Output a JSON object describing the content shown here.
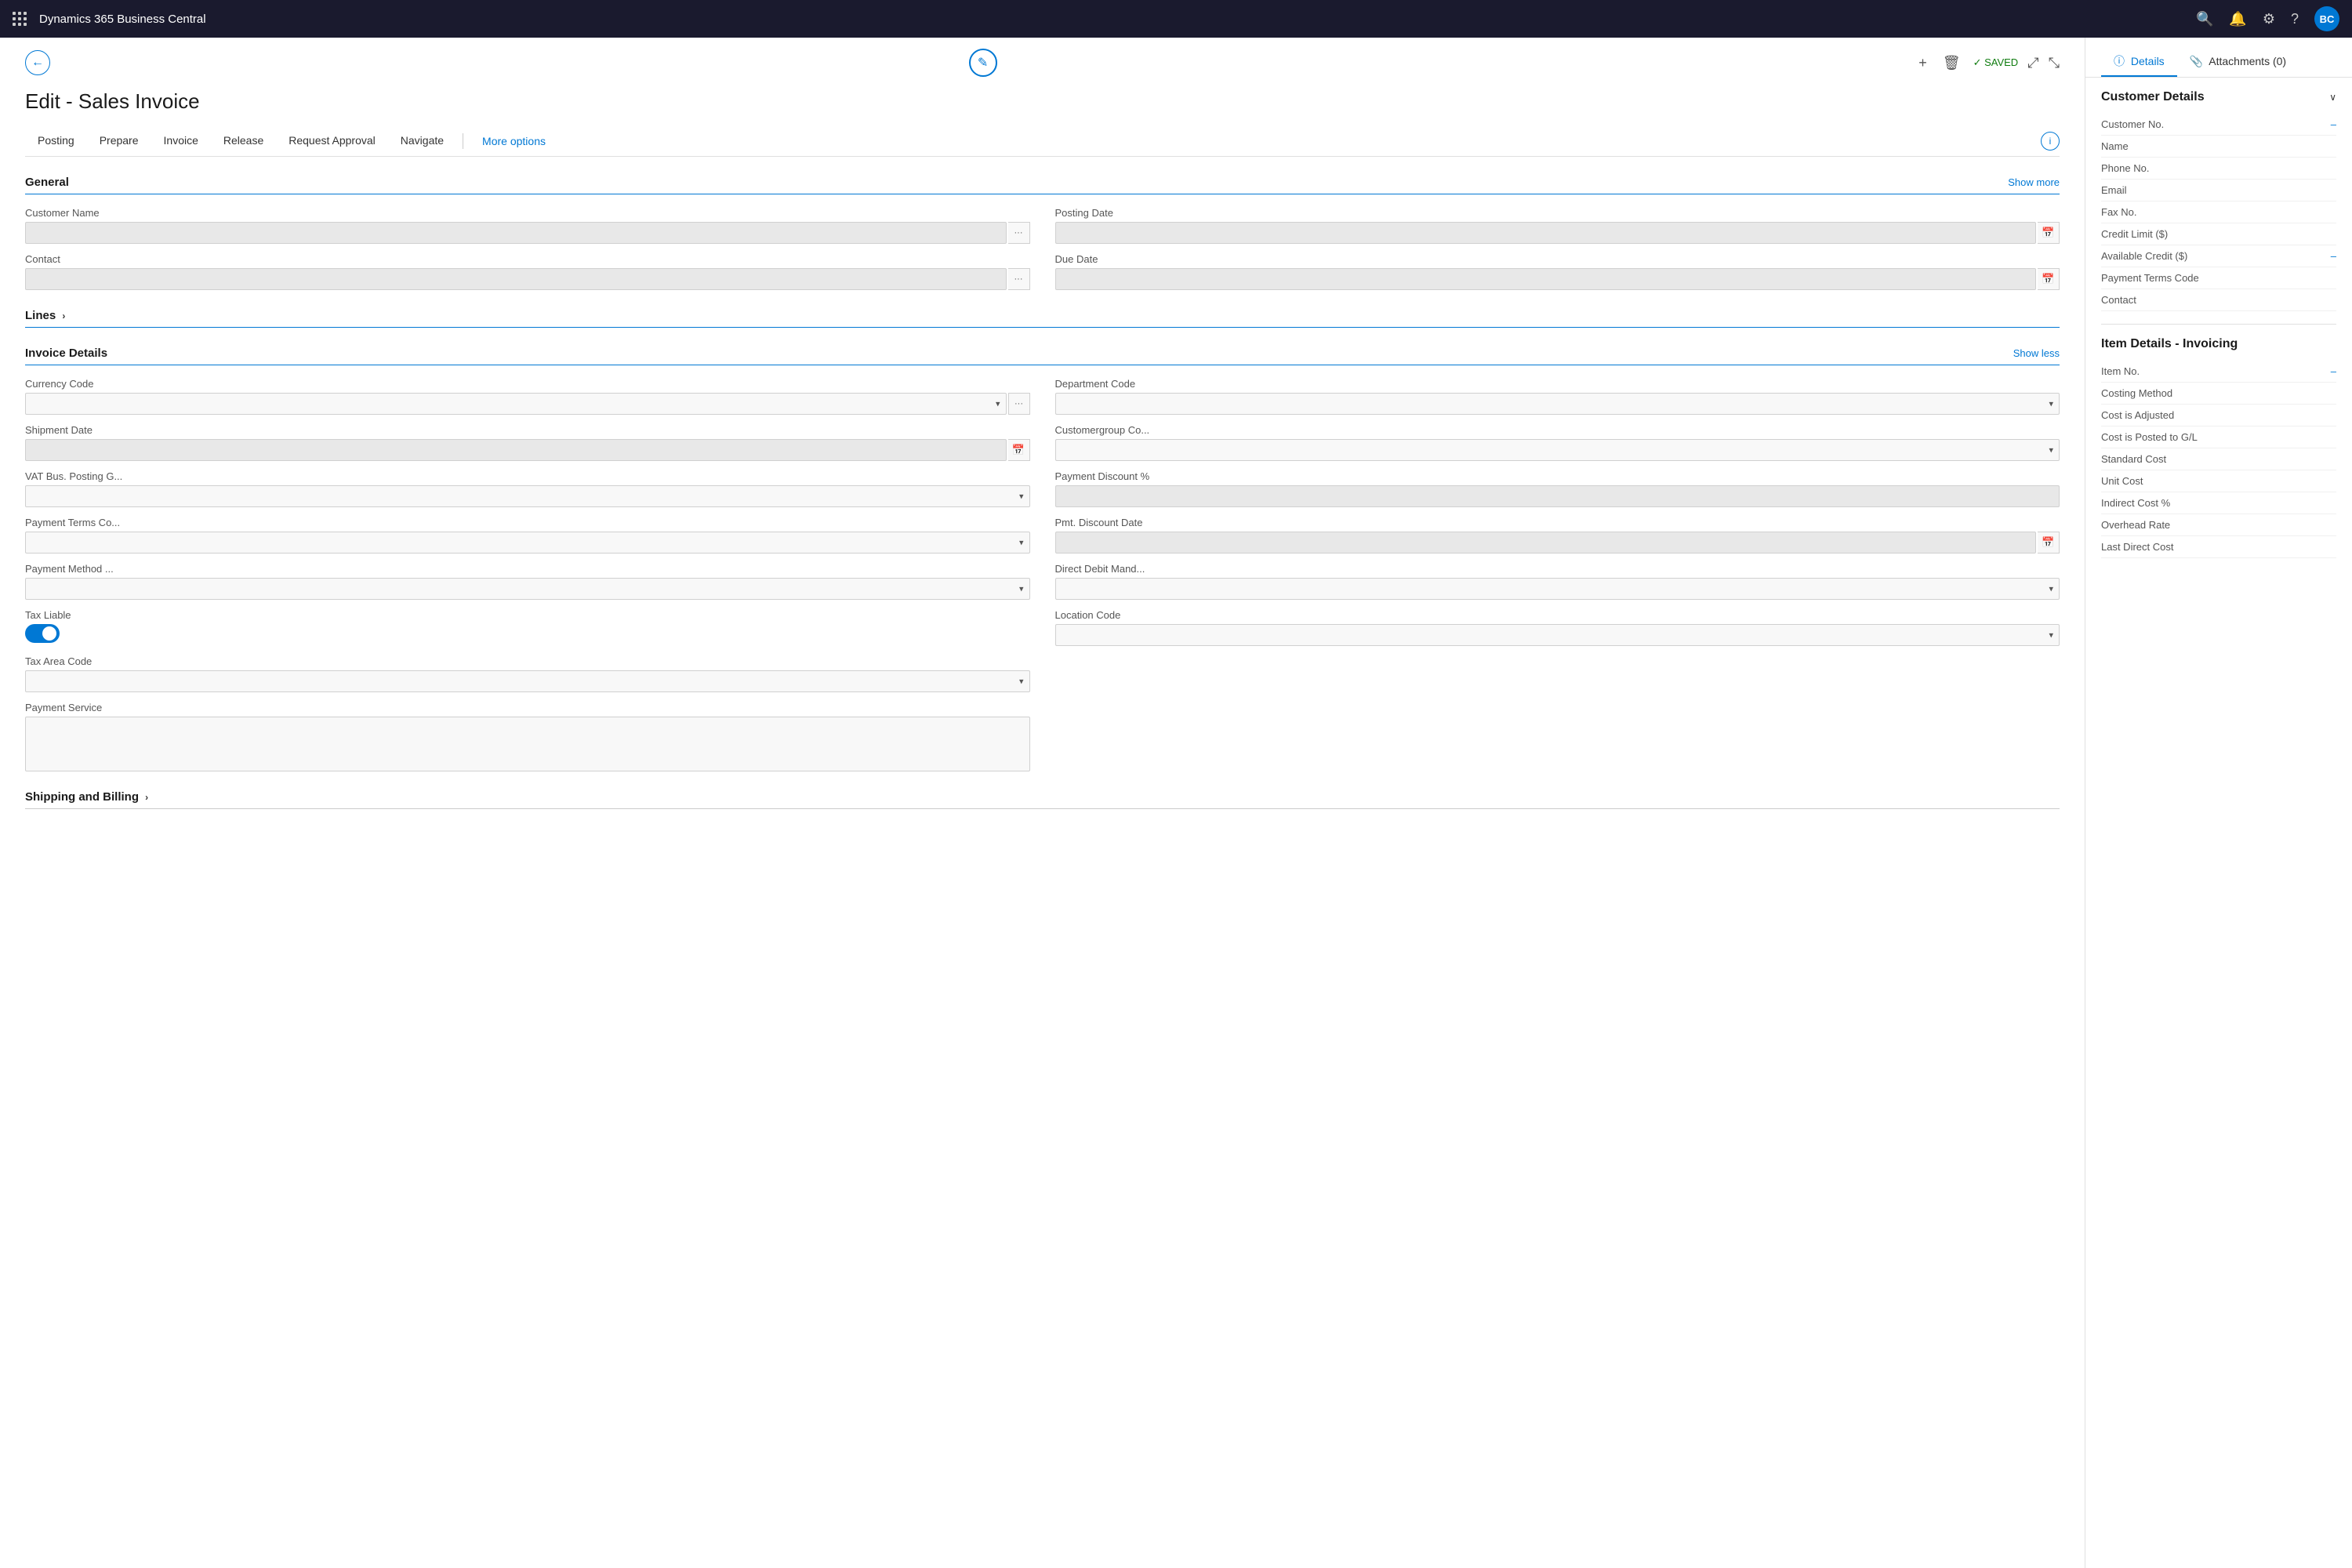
{
  "app": {
    "name": "Dynamics 365 Business Central",
    "user_initials": "BC"
  },
  "toolbar": {
    "back_label": "←",
    "edit_icon": "✎",
    "add_icon": "+",
    "delete_icon": "🗑",
    "saved_label": "✓ SAVED",
    "expand_icon": "⤢",
    "collapse_icon": "⤡"
  },
  "page": {
    "title": "Edit - Sales Invoice"
  },
  "nav": {
    "tabs": [
      {
        "label": "Posting",
        "active": false
      },
      {
        "label": "Prepare",
        "active": false
      },
      {
        "label": "Invoice",
        "active": false
      },
      {
        "label": "Release",
        "active": false
      },
      {
        "label": "Request Approval",
        "active": false
      },
      {
        "label": "Navigate",
        "active": false
      }
    ],
    "more_options": "More options"
  },
  "general": {
    "title": "General",
    "show_more": "Show more",
    "fields": [
      {
        "label": "Customer Name",
        "type": "input_with_btn",
        "value": "",
        "placeholder": ""
      },
      {
        "label": "Posting Date",
        "type": "date",
        "value": "",
        "placeholder": ""
      },
      {
        "label": "Contact",
        "type": "input_with_btn",
        "value": "",
        "placeholder": ""
      },
      {
        "label": "Due Date",
        "type": "date",
        "value": "",
        "placeholder": ""
      }
    ]
  },
  "lines": {
    "title": "Lines"
  },
  "invoice_details": {
    "title": "Invoice Details",
    "show_less": "Show less",
    "fields_left": [
      {
        "label": "Currency Code",
        "type": "select_with_btn",
        "value": ""
      },
      {
        "label": "Shipment Date",
        "type": "date",
        "value": ""
      },
      {
        "label": "VAT Bus. Posting G...",
        "type": "select",
        "value": ""
      },
      {
        "label": "Payment Terms Co...",
        "type": "select",
        "value": ""
      },
      {
        "label": "Payment Method ...",
        "type": "select",
        "value": ""
      },
      {
        "label": "Tax Liable",
        "type": "toggle",
        "value": true
      },
      {
        "label": "Tax Area Code",
        "type": "select",
        "value": ""
      },
      {
        "label": "Payment Service",
        "type": "textarea",
        "value": ""
      }
    ],
    "fields_right": [
      {
        "label": "Department Code",
        "type": "select",
        "value": ""
      },
      {
        "label": "Customergroup Co...",
        "type": "select",
        "value": ""
      },
      {
        "label": "Payment Discount %",
        "type": "input",
        "value": ""
      },
      {
        "label": "Pmt. Discount Date",
        "type": "date",
        "value": ""
      },
      {
        "label": "Direct Debit Mand...",
        "type": "select",
        "value": ""
      },
      {
        "label": "Location Code",
        "type": "select",
        "value": ""
      }
    ]
  },
  "shipping": {
    "title": "Shipping and Billing"
  },
  "right_panel": {
    "tabs": [
      {
        "label": "Details",
        "icon": "ⓘ",
        "active": true
      },
      {
        "label": "Attachments (0)",
        "icon": "📎",
        "active": false
      }
    ],
    "customer_details": {
      "title": "Customer Details",
      "fields": [
        {
          "label": "Customer No.",
          "value": "–"
        },
        {
          "label": "Name",
          "value": ""
        },
        {
          "label": "Phone No.",
          "value": ""
        },
        {
          "label": "Email",
          "value": ""
        },
        {
          "label": "Fax No.",
          "value": ""
        },
        {
          "label": "Credit Limit ($)",
          "value": ""
        },
        {
          "label": "Available Credit ($)",
          "value": "–"
        },
        {
          "label": "Payment Terms Code",
          "value": ""
        },
        {
          "label": "Contact",
          "value": ""
        }
      ]
    },
    "item_details": {
      "title": "Item Details - Invoicing",
      "fields": [
        {
          "label": "Item No.",
          "value": "–"
        },
        {
          "label": "Costing Method",
          "value": ""
        },
        {
          "label": "Cost is Adjusted",
          "value": ""
        },
        {
          "label": "Cost is Posted to G/L",
          "value": ""
        },
        {
          "label": "Standard Cost",
          "value": ""
        },
        {
          "label": "Unit Cost",
          "value": ""
        },
        {
          "label": "Indirect Cost %",
          "value": ""
        },
        {
          "label": "Overhead Rate",
          "value": ""
        },
        {
          "label": "Last Direct Cost",
          "value": ""
        }
      ]
    }
  }
}
